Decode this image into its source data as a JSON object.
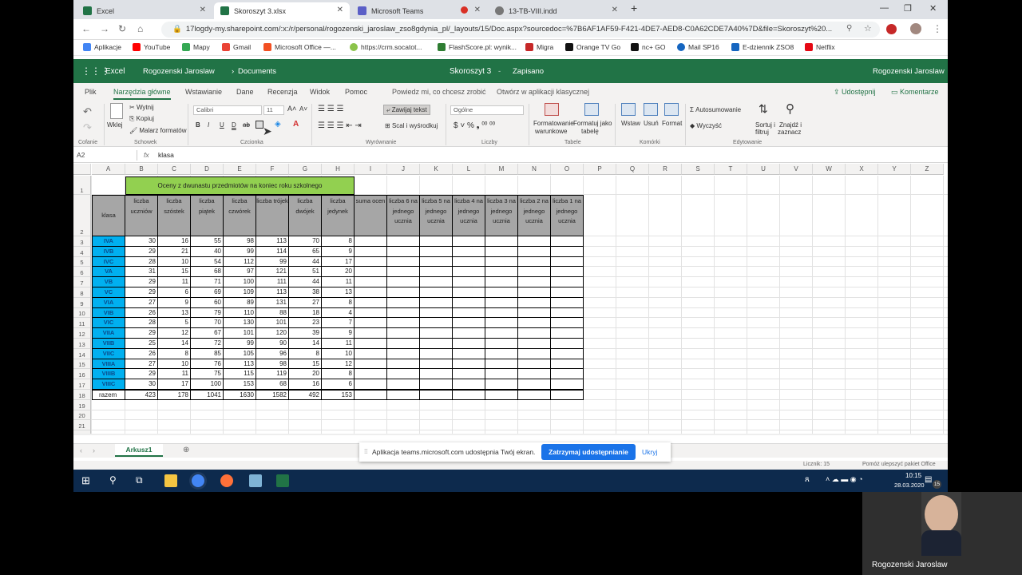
{
  "browser": {
    "tabs": [
      {
        "label": "Excel",
        "color": "#217346"
      },
      {
        "label": "Skoroszyt 3.xlsx",
        "color": "#217346"
      },
      {
        "label": "Microsoft Teams",
        "color": "#5b5fc7"
      },
      {
        "label": "13-TB-VIII.indd",
        "color": "#777777"
      }
    ],
    "url": "17logdy-my.sharepoint.com/:x:/r/personal/rogozenski_jaroslaw_zso8gdynia_pl/_layouts/15/Doc.aspx?sourcedoc=%7B6AF1AF59-F421-4DE7-AED8-C0A62CDE7A40%7D&file=Skoroszyt%20...",
    "bookmarks": [
      "Aplikacje",
      "YouTube",
      "Mapy",
      "Gmail",
      "Microsoft Office —...",
      "https://crm.socatot...",
      "FlashScore.pl: wynik...",
      "Migra",
      "Orange TV Go",
      "nc+ GO",
      "Mail SP16",
      "E-dziennik ZSO8",
      "Netflix"
    ]
  },
  "excel": {
    "app": "Excel",
    "breadcrumb_user": "Rogozenski Jaroslaw",
    "breadcrumb_sep": "›",
    "breadcrumb_folder": "Documents",
    "file_name": "Skoroszyt 3",
    "save_status": "Zapisano",
    "user_name": "Rogozenski Jaroslaw",
    "ribbon_tabs": [
      "Plik",
      "Narzędzia główne",
      "Wstawianie",
      "Dane",
      "Recenzja",
      "Widok",
      "Pomoc"
    ],
    "tell_me": "Powiedz mi, co chcesz zrobić",
    "open_desktop": "Otwórz w aplikacji klasycznej",
    "share": "Udostępnij",
    "comments": "Komentarze",
    "ribbon": {
      "undo_group": "Cofanie",
      "paste": "Wklej",
      "cut": "Wytnij",
      "copy": "Kopiuj",
      "format_painter": "Malarz formatów",
      "clipboard_group": "Schowek",
      "font_name": "Calibri",
      "font_size": "11",
      "font_group": "Czcionka",
      "wrap_text": "Zawijaj tekst",
      "merge": "Scal i wyśrodkuj",
      "alignment_group": "Wyrównanie",
      "number_format": "Ogólne",
      "number_group": "Liczby",
      "cond_format_1": "Formatowanie",
      "cond_format_2": "warunkowe",
      "format_table_1": "Formatuj jako",
      "format_table_2": "tabelę",
      "tables_group": "Tabele",
      "insert": "Wstaw",
      "delete": "Usuń",
      "format": "Format",
      "cells_group": "Komórki",
      "autosum": "Autosumowanie",
      "clear": "Wyczyść",
      "sort_1": "Sortuj i",
      "sort_2": "filtruj",
      "find_1": "Znajdź i",
      "find_2": "zaznacz",
      "editing_group": "Edytowanie"
    },
    "name_box": "A2",
    "fx": "fx",
    "formula": "klasa",
    "sheet_tab": "Arkusz1",
    "status_count": "Licznik: 15",
    "status_help": "Pomóż ulepszyć pakiet Office"
  },
  "sheet": {
    "columns": [
      "A",
      "B",
      "C",
      "D",
      "E",
      "F",
      "G",
      "H",
      "I",
      "J",
      "K",
      "L",
      "M",
      "N",
      "O",
      "P",
      "Q",
      "R",
      "S",
      "T",
      "U",
      "V",
      "W",
      "X",
      "Y",
      "Z"
    ],
    "row_numbers": [
      "1",
      "2",
      "3",
      "4",
      "5",
      "6",
      "7",
      "8",
      "9",
      "10",
      "11",
      "12",
      "13",
      "14",
      "15",
      "16",
      "17",
      "18",
      "19",
      "20",
      "21",
      "22"
    ],
    "title": "Oceny z dwunastu przedmiotów na koniec roku szkolnego",
    "headers": [
      "klasa",
      "liczba uczniów",
      "liczba szóstek",
      "liczba piątek",
      "liczba czwórek",
      "liczba trójek",
      "liczba dwójek",
      "liczba jedynek",
      "suma ocen",
      "liczba 6 na jednego ucznia",
      "liczba 5 na jednego ucznia",
      "liczba 4 na jednego ucznia",
      "liczba 3 na jednego ucznia",
      "liczba 2 na jednego ucznia",
      "liczba 1 na jednego ucznia"
    ],
    "rows": [
      [
        "IVA",
        "30",
        "16",
        "55",
        "98",
        "113",
        "70",
        "8"
      ],
      [
        "IVB",
        "29",
        "21",
        "40",
        "99",
        "114",
        "65",
        "9"
      ],
      [
        "IVC",
        "28",
        "10",
        "54",
        "112",
        "99",
        "44",
        "17"
      ],
      [
        "VA",
        "31",
        "15",
        "68",
        "97",
        "121",
        "51",
        "20"
      ],
      [
        "VB",
        "29",
        "11",
        "71",
        "100",
        "111",
        "44",
        "11"
      ],
      [
        "VC",
        "29",
        "6",
        "69",
        "109",
        "113",
        "38",
        "13"
      ],
      [
        "VIA",
        "27",
        "9",
        "60",
        "89",
        "131",
        "27",
        "8"
      ],
      [
        "VIB",
        "26",
        "13",
        "79",
        "110",
        "88",
        "18",
        "4"
      ],
      [
        "VIC",
        "28",
        "5",
        "70",
        "130",
        "101",
        "23",
        "7"
      ],
      [
        "VIIA",
        "29",
        "12",
        "67",
        "101",
        "120",
        "39",
        "9"
      ],
      [
        "VIIB",
        "25",
        "14",
        "72",
        "99",
        "90",
        "14",
        "11"
      ],
      [
        "VIIC",
        "26",
        "8",
        "85",
        "105",
        "96",
        "8",
        "10"
      ],
      [
        "VIIIA",
        "27",
        "10",
        "76",
        "113",
        "98",
        "15",
        "12"
      ],
      [
        "VIIIB",
        "29",
        "11",
        "75",
        "115",
        "119",
        "20",
        "8"
      ],
      [
        "VIIIC",
        "30",
        "17",
        "100",
        "153",
        "68",
        "16",
        "6"
      ]
    ],
    "total_row": [
      "razem",
      "423",
      "178",
      "1041",
      "1630",
      "1582",
      "492",
      "153"
    ]
  },
  "share_banner": {
    "text": "Aplikacja teams.microsoft.com udostępnia Twój ekran.",
    "stop": "Zatrzymaj udostępnianie",
    "hide": "Ukryj"
  },
  "taskbar": {
    "time": "10:15",
    "date": "28.03.2020",
    "badge": "15"
  },
  "video": {
    "name": "Rogozenski Jaroslaw"
  }
}
